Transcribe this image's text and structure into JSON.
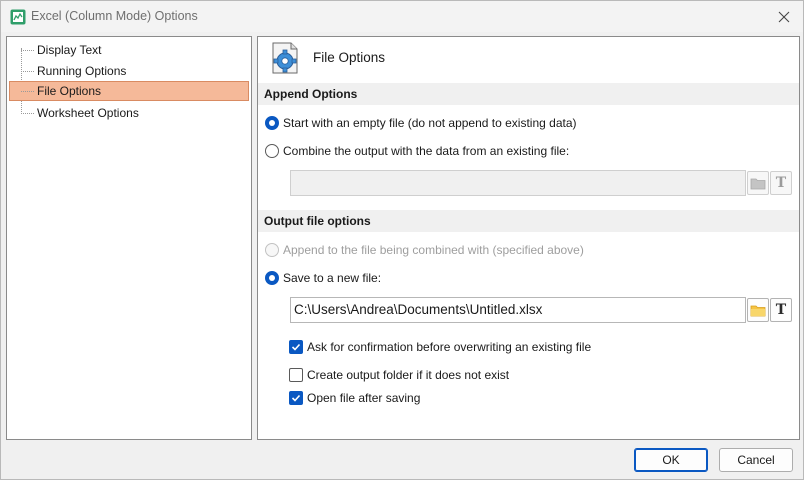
{
  "window": {
    "title": "Excel (Column Mode) Options"
  },
  "tree": {
    "items": [
      {
        "label": "Display Text",
        "selected": false
      },
      {
        "label": "Running Options",
        "selected": false
      },
      {
        "label": "File Options",
        "selected": true
      },
      {
        "label": "Worksheet Options",
        "selected": false
      }
    ]
  },
  "panel": {
    "title": "File Options",
    "append_section": {
      "heading": "Append Options",
      "option_empty": "Start with an empty file (do not append to existing data)",
      "option_combine": "Combine the output with the data from an existing file:",
      "selected": "option_empty",
      "existing_file_value": ""
    },
    "output_section": {
      "heading": "Output file options",
      "option_append": "Append to the file being combined with (specified above)",
      "option_new": "Save to a new file:",
      "selected": "option_new",
      "new_file_value": "C:\\Users\\Andrea\\Documents\\Untitled.xlsx",
      "confirm_overwrite": {
        "label": "Ask for confirmation before overwriting an existing file",
        "checked": true
      },
      "create_folder": {
        "label": "Create output folder if it does not exist",
        "checked": false
      },
      "open_after": {
        "label": "Open file after saving",
        "checked": true
      }
    },
    "text_button_glyph": "T"
  },
  "buttons": {
    "ok": "OK",
    "cancel": "Cancel"
  },
  "colors": {
    "accent": "#0a58c2",
    "selection": "#f5b999",
    "folder": "#f5c342"
  }
}
